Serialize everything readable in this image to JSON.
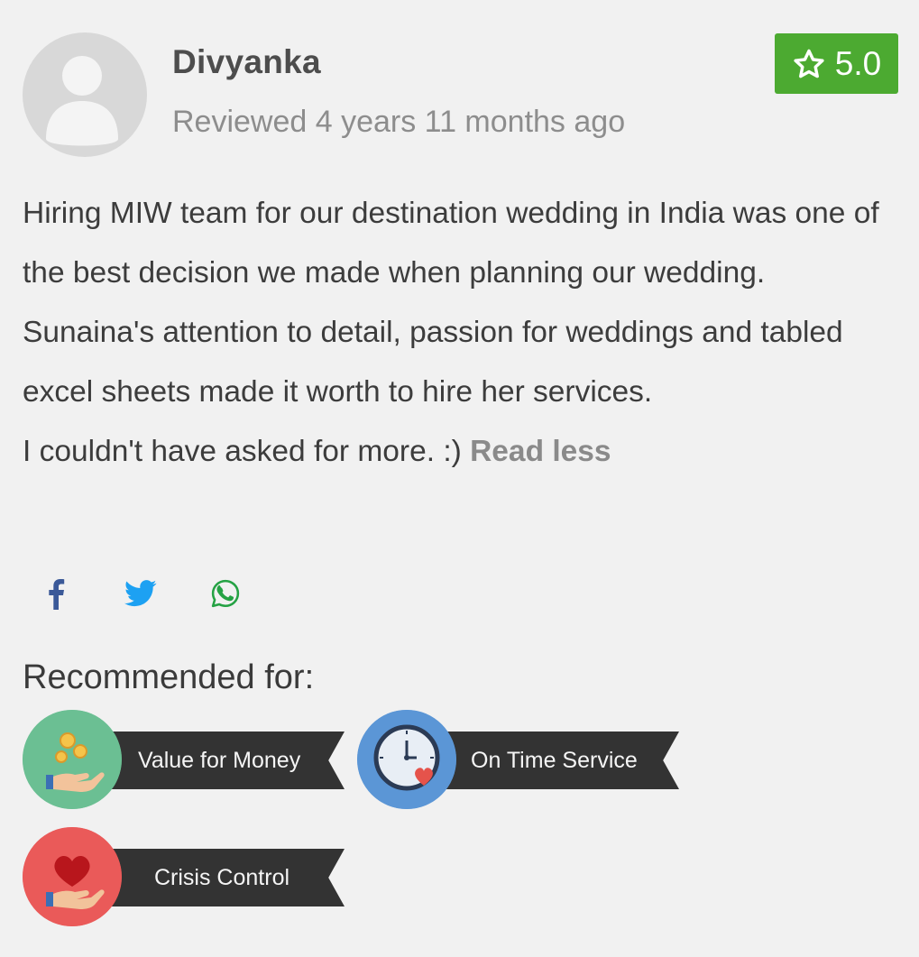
{
  "review": {
    "reviewer_name": "Divyanka",
    "review_time": "Reviewed 4 years 11 months ago",
    "rating": "5.0",
    "text_lines": [
      "Hiring MIW team for our destination wedding in India was one of the best decision we made when planning our wedding.",
      "Sunaina's attention to detail, passion for weddings and tabled excel sheets made it worth to hire her services.",
      "I couldn't have asked for more. :)"
    ],
    "read_less_label": "Read less"
  },
  "share": {
    "items": [
      {
        "name": "facebook",
        "icon": "facebook-icon",
        "color": "#3b5998"
      },
      {
        "name": "twitter",
        "icon": "twitter-icon",
        "color": "#1da1f2"
      },
      {
        "name": "whatsapp",
        "icon": "whatsapp-icon",
        "color": "#25a244"
      }
    ]
  },
  "recommended": {
    "heading": "Recommended for:",
    "items": [
      {
        "label": "Value for Money",
        "icon": "coins-in-hand-icon",
        "color": "#6bbf93"
      },
      {
        "label": "On Time Service",
        "icon": "clock-with-heart-icon",
        "color": "#5b96d6"
      },
      {
        "label": "Crisis Control",
        "icon": "heart-in-hand-icon",
        "color": "#ea5a59"
      }
    ]
  },
  "colors": {
    "rating_badge": "#4caa31",
    "ribbon": "#333333",
    "background": "#f1f1f1"
  }
}
